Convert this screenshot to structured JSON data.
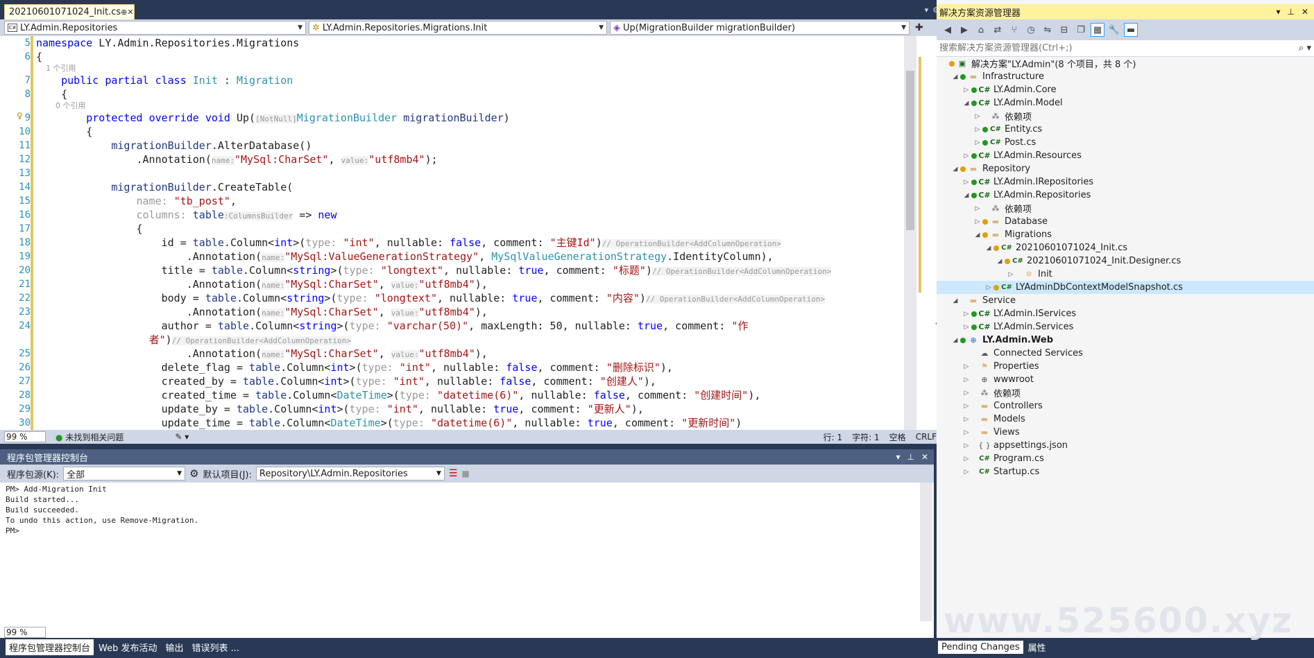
{
  "editor": {
    "tab_title": "20210601071024_Init.cs",
    "tab_pin": "⊕",
    "tab_close": "✕",
    "nav": {
      "project": "LY.Admin.Repositories",
      "type": "LY.Admin.Repositories.Migrations.Init",
      "member": "Up(MigrationBuilder migrationBuilder)"
    },
    "lines": [
      {
        "n": "5",
        "html": "<span class=\"k\">namespace</span> LY.Admin.Repositories.Migrations"
      },
      {
        "n": "6",
        "html": "{"
      },
      {
        "lens": "    1 个引用"
      },
      {
        "n": "7",
        "html": "    <span class=\"k\">public</span> <span class=\"k\">partial</span> <span class=\"k\">class</span> <span class=\"t\">Init</span> : <span class=\"t\">Migration</span>"
      },
      {
        "n": "8",
        "html": "    {"
      },
      {
        "lens": "        0 个引用"
      },
      {
        "n": "9",
        "html": "        <span class=\"k\">protected</span> <span class=\"k\">override</span> <span class=\"k\">void</span> Up(<span class=\"hint\">[NotNull]</span><span class=\"t\">MigrationBuilder</span> <span class=\"i\">migrationBuilder</span>)"
      },
      {
        "n": "10",
        "html": "        {"
      },
      {
        "n": "11",
        "html": "            <span class=\"i\">migrationBuilder</span>.AlterDatabase()"
      },
      {
        "n": "12",
        "html": "                .Annotation(<span class=\"hint\">name:</span><span class=\"s\">\"MySql:CharSet\"</span>, <span class=\"hint\">value:</span><span class=\"s\">\"utf8mb4\"</span>);"
      },
      {
        "n": "13",
        "html": ""
      },
      {
        "n": "14",
        "html": "            <span class=\"i\">migrationBuilder</span>.CreateTable("
      },
      {
        "n": "15",
        "html": "                <span class=\"c\">name:</span> <span class=\"s\">\"tb_post\"</span>,"
      },
      {
        "n": "16",
        "html": "                <span class=\"c\">columns:</span> <span class=\"i\">table</span><span class=\"hint\">:ColumnsBuilder</span> => <span class=\"k\">new</span>"
      },
      {
        "n": "17",
        "html": "                {"
      },
      {
        "n": "18",
        "html": "                    id = <span class=\"i\">table</span>.Column&lt;<span class=\"k\">int</span>&gt;(<span class=\"c\">type:</span> <span class=\"s\">\"int\"</span>, nullable: <span class=\"k\">false</span>, comment: <span class=\"s\">\"主键Id\"</span>)<span class=\"hint\">// OperationBuilder&lt;AddColumnOperation&gt;</span>"
      },
      {
        "n": "19",
        "html": "                        .Annotation(<span class=\"hint\">name:</span><span class=\"s\">\"MySql:ValueGenerationStrategy\"</span>, <span class=\"t\">MySqlValueGenerationStrategy</span>.IdentityColumn),"
      },
      {
        "n": "20",
        "html": "                    title = <span class=\"i\">table</span>.Column&lt;<span class=\"k\">string</span>&gt;(<span class=\"c\">type:</span> <span class=\"s\">\"longtext\"</span>, nullable: <span class=\"k\">true</span>, comment: <span class=\"s\">\"标题\"</span>)<span class=\"hint\">// OperationBuilder&lt;AddColumnOperation&gt;</span>"
      },
      {
        "n": "21",
        "html": "                        .Annotation(<span class=\"hint\">name:</span><span class=\"s\">\"MySql:CharSet\"</span>, <span class=\"hint\">value:</span><span class=\"s\">\"utf8mb4\"</span>),"
      },
      {
        "n": "22",
        "html": "                    body = <span class=\"i\">table</span>.Column&lt;<span class=\"k\">string</span>&gt;(<span class=\"c\">type:</span> <span class=\"s\">\"longtext\"</span>, nullable: <span class=\"k\">true</span>, comment: <span class=\"s\">\"内容\"</span>)<span class=\"hint\">// OperationBuilder&lt;AddColumnOperation&gt;</span>"
      },
      {
        "n": "23",
        "html": "                        .Annotation(<span class=\"hint\">name:</span><span class=\"s\">\"MySql:CharSet\"</span>, <span class=\"hint\">value:</span><span class=\"s\">\"utf8mb4\"</span>),"
      },
      {
        "n": "24",
        "html": "                    author = <span class=\"i\">table</span>.Column&lt;<span class=\"k\">string</span>&gt;(<span class=\"c\">type:</span> <span class=\"s\">\"varchar(50)\"</span>, maxLength: 50, nullable: <span class=\"k\">true</span>, comment: <span class=\"s\">\"作</span>"
      },
      {
        "n": "",
        "html": "                  <span class=\"s\">者\"</span>)<span class=\"hint\">// OperationBuilder&lt;AddColumnOperation&gt;</span>"
      },
      {
        "n": "25",
        "html": "                        .Annotation(<span class=\"hint\">name:</span><span class=\"s\">\"MySql:CharSet\"</span>, <span class=\"hint\">value:</span><span class=\"s\">\"utf8mb4\"</span>),"
      },
      {
        "n": "26",
        "html": "                    delete_flag = <span class=\"i\">table</span>.Column&lt;<span class=\"k\">int</span>&gt;(<span class=\"c\">type:</span> <span class=\"s\">\"int\"</span>, nullable: <span class=\"k\">false</span>, comment: <span class=\"s\">\"删除标识\"</span>),"
      },
      {
        "n": "27",
        "html": "                    created_by = <span class=\"i\">table</span>.Column&lt;<span class=\"k\">int</span>&gt;(<span class=\"c\">type:</span> <span class=\"s\">\"int\"</span>, nullable: <span class=\"k\">false</span>, comment: <span class=\"s\">\"创建人\"</span>),"
      },
      {
        "n": "28",
        "html": "                    created_time = <span class=\"i\">table</span>.Column&lt;<span class=\"t\">DateTime</span>&gt;(<span class=\"c\">type:</span> <span class=\"s\">\"datetime(6)\"</span>, nullable: <span class=\"k\">false</span>, comment: <span class=\"s\">\"创建时间\"</span>),"
      },
      {
        "n": "29",
        "html": "                    update_by = <span class=\"i\">table</span>.Column&lt;<span class=\"k\">int</span>&gt;(<span class=\"c\">type:</span> <span class=\"s\">\"int\"</span>, nullable: <span class=\"k\">true</span>, comment: <span class=\"s\">\"更新人\"</span>),"
      },
      {
        "n": "30",
        "html": "                    update_time = <span class=\"i\">table</span>.Column&lt;<span class=\"t\">DateTime</span>&gt;(<span class=\"c\">type:</span> <span class=\"s\">\"datetime(6)\"</span>, nullable: <span class=\"k\">true</span>, comment: <span class=\"s\">\"更新时间\"</span>)"
      }
    ],
    "status": {
      "zoom": "99 %",
      "issues": "未找到相关问题",
      "line": "行: 1",
      "char": "字符: 1",
      "indent": "空格",
      "eol": "CRLF"
    }
  },
  "pmc": {
    "title": "程序包管理器控制台",
    "source_label": "程序包源(K):",
    "source_value": "全部",
    "project_label": "默认项目(J):",
    "project_value": "Repository\\LY.Admin.Repositories",
    "output": "PM> Add-Migration Init\nBuild started...\nBuild succeeded.\nTo undo this action, use Remove-Migration.\nPM>",
    "zoom": "99 %"
  },
  "bottom_tabs": [
    "程序包管理器控制台",
    "Web 发布活动",
    "输出",
    "错误列表 ..."
  ],
  "solution_explorer": {
    "title": "解决方案资源管理器",
    "search_placeholder": "搜索解决方案资源管理器(Ctrl+;)",
    "tabs": [
      "Pending Changes",
      "属性"
    ],
    "nodes": [
      {
        "depth": 0,
        "exp": "",
        "status": "y",
        "icon": "sln",
        "label": "解决方案\"LY.Admin\"(8 个项目，共 8 个)"
      },
      {
        "depth": 1,
        "exp": "◢",
        "status": "g",
        "icon": "fold",
        "label": "Infrastructure"
      },
      {
        "depth": 2,
        "exp": "▷",
        "status": "g",
        "icon": "proj",
        "label": "LY.Admin.Core"
      },
      {
        "depth": 2,
        "exp": "◢",
        "status": "g",
        "icon": "proj",
        "label": "LY.Admin.Model"
      },
      {
        "depth": 3,
        "exp": "▷",
        "status": "",
        "icon": "dep",
        "label": "依赖项"
      },
      {
        "depth": 3,
        "exp": "▷",
        "status": "g",
        "icon": "cs",
        "label": "Entity.cs"
      },
      {
        "depth": 3,
        "exp": "▷",
        "status": "g",
        "icon": "cs",
        "label": "Post.cs"
      },
      {
        "depth": 2,
        "exp": "▷",
        "status": "g",
        "icon": "proj",
        "label": "LY.Admin.Resources"
      },
      {
        "depth": 1,
        "exp": "◢",
        "status": "y",
        "icon": "fold",
        "label": "Repository"
      },
      {
        "depth": 2,
        "exp": "▷",
        "status": "g",
        "icon": "proj",
        "label": "LY.Admin.IRepositories"
      },
      {
        "depth": 2,
        "exp": "◢",
        "status": "g",
        "icon": "proj",
        "label": "LY.Admin.Repositories"
      },
      {
        "depth": 3,
        "exp": "▷",
        "status": "",
        "icon": "dep",
        "label": "依赖项"
      },
      {
        "depth": 3,
        "exp": "▷",
        "status": "y",
        "icon": "fold",
        "label": "Database"
      },
      {
        "depth": 3,
        "exp": "◢",
        "status": "y",
        "icon": "fold",
        "label": "Migrations"
      },
      {
        "depth": 4,
        "exp": "◢",
        "status": "y",
        "icon": "cs",
        "label": "20210601071024_Init.cs"
      },
      {
        "depth": 5,
        "exp": "◢",
        "status": "y",
        "icon": "cs",
        "label": "20210601071024_Init.Designer.cs"
      },
      {
        "depth": 6,
        "exp": "▷",
        "status": "",
        "icon": "class",
        "label": "Init"
      },
      {
        "depth": 4,
        "exp": "▷",
        "status": "y",
        "icon": "cs",
        "label": "LYAdminDbContextModelSnapshot.cs",
        "selected": true
      },
      {
        "depth": 1,
        "exp": "◢",
        "status": "",
        "icon": "fold",
        "label": "Service"
      },
      {
        "depth": 2,
        "exp": "▷",
        "status": "g",
        "icon": "proj",
        "label": "LY.Admin.IServices"
      },
      {
        "depth": 2,
        "exp": "▷",
        "status": "g",
        "icon": "proj",
        "label": "LY.Admin.Services"
      },
      {
        "depth": 1,
        "exp": "◢",
        "status": "g",
        "icon": "web",
        "label": "LY.Admin.Web",
        "bold": true
      },
      {
        "depth": 2,
        "exp": "",
        "status": "",
        "icon": "conn",
        "label": "Connected Services"
      },
      {
        "depth": 2,
        "exp": "▷",
        "status": "",
        "icon": "prop",
        "label": "Properties"
      },
      {
        "depth": 2,
        "exp": "▷",
        "status": "",
        "icon": "globe",
        "label": "wwwroot"
      },
      {
        "depth": 2,
        "exp": "▷",
        "status": "",
        "icon": "dep",
        "label": "依赖项"
      },
      {
        "depth": 2,
        "exp": "▷",
        "status": "",
        "icon": "fold",
        "label": "Controllers"
      },
      {
        "depth": 2,
        "exp": "▷",
        "status": "",
        "icon": "fold",
        "label": "Models"
      },
      {
        "depth": 2,
        "exp": "▷",
        "status": "",
        "icon": "fold",
        "label": "Views"
      },
      {
        "depth": 2,
        "exp": "▷",
        "status": "",
        "icon": "json",
        "label": "appsettings.json"
      },
      {
        "depth": 2,
        "exp": "▷",
        "status": "",
        "icon": "cs",
        "label": "Program.cs"
      },
      {
        "depth": 2,
        "exp": "▷",
        "status": "",
        "icon": "cs",
        "label": "Startup.cs"
      }
    ]
  },
  "watermark": "www.525600.xyz",
  "colors": {
    "chrome": "#293955",
    "toolbar": "#cfd6e5",
    "active_title": "#fff29d",
    "selection": "#cce8ff"
  }
}
